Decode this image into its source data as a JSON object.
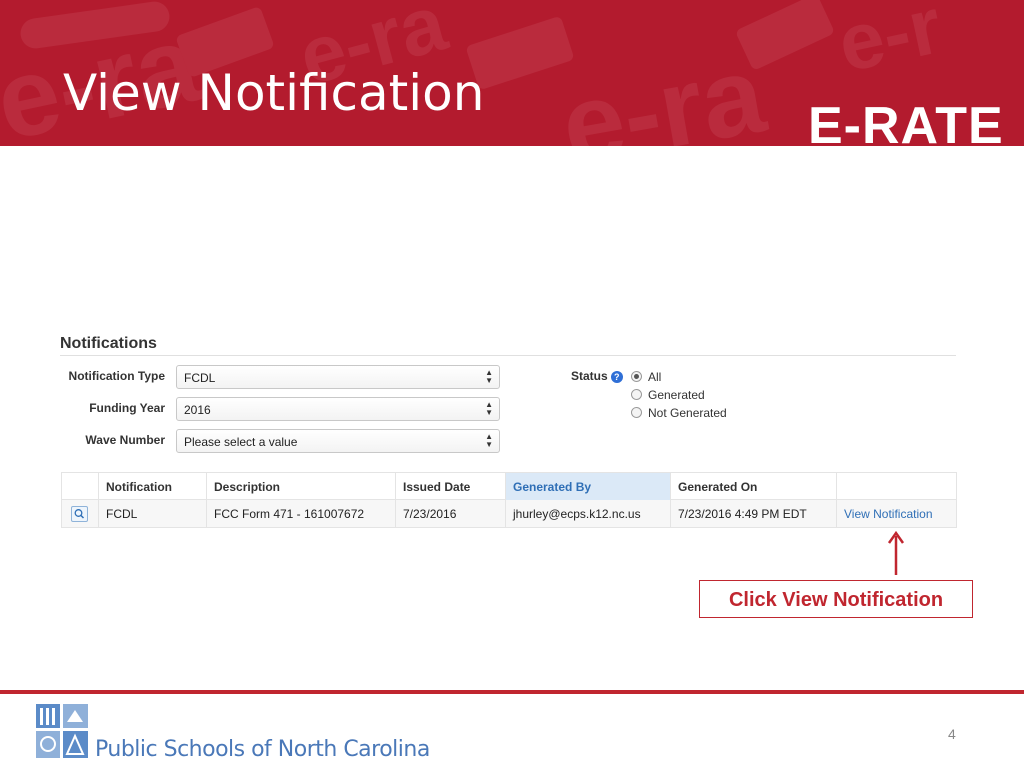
{
  "slide": {
    "title": "View Notification",
    "logo_text": "E-RATE",
    "page_number": "4"
  },
  "notifications": {
    "section_title": "Notifications",
    "fields": {
      "notification_type_label": "Notification Type",
      "notification_type_value": "FCDL",
      "funding_year_label": "Funding Year",
      "funding_year_value": "2016",
      "wave_number_label": "Wave Number",
      "wave_number_value": "Please select a value"
    },
    "status": {
      "label": "Status",
      "help_glyph": "?",
      "options": [
        {
          "label": "All",
          "checked": true
        },
        {
          "label": "Generated",
          "checked": false
        },
        {
          "label": "Not Generated",
          "checked": false
        }
      ]
    },
    "table": {
      "columns": [
        "Notification",
        "Description",
        "Issued Date",
        "Generated By",
        "Generated On"
      ],
      "sorted_column": "Generated By",
      "rows": [
        {
          "notification": "FCDL",
          "description": "FCC Form 471 - 161007672",
          "issued_date": "7/23/2016",
          "generated_by": "jhurley@ecps.k12.nc.us",
          "generated_on": "7/23/2016 4:49 PM EDT",
          "action": "View Notification"
        }
      ]
    }
  },
  "callout": {
    "text": "Click View Notification",
    "color": "#c0262f"
  },
  "footer": {
    "text": "Public Schools of North Carolina"
  },
  "icons": {
    "search": "magnifier-icon",
    "help": "help-icon",
    "arrow": "up-arrow-icon"
  },
  "colors": {
    "banner": "#b31b2e",
    "link": "#2f6fb6",
    "footer_text": "#4a78b8"
  }
}
